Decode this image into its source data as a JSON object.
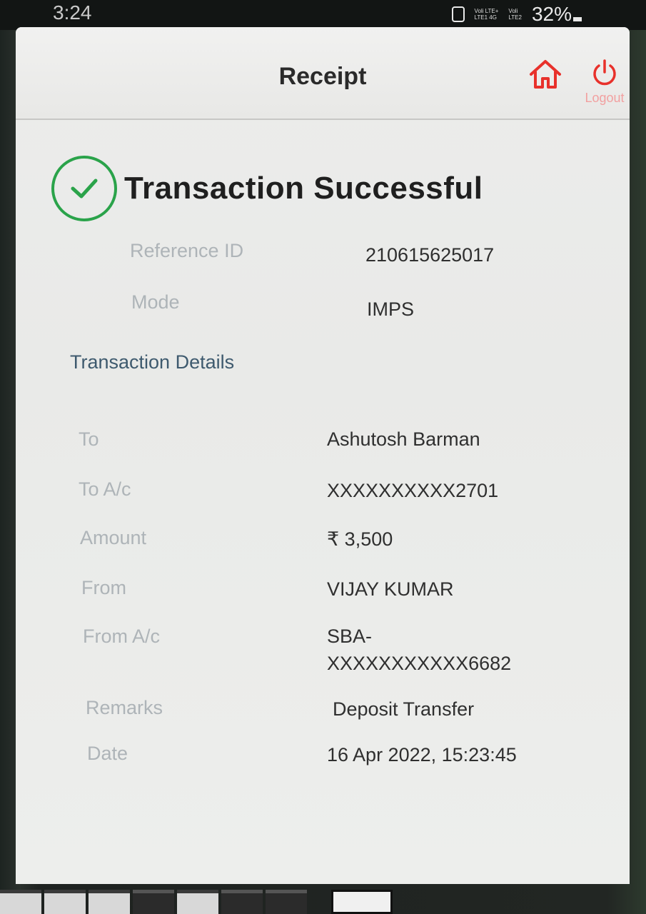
{
  "status_bar": {
    "time": "3:24",
    "network_1_top": "Voli LTE+",
    "network_1_bottom": "LTE1 4G",
    "network_2_top": "Voli",
    "network_2_bottom": "LTE2",
    "battery": "32%"
  },
  "header": {
    "title": "Receipt",
    "home_icon": "home-icon",
    "logout_icon": "power-icon",
    "logout_label": "Logout"
  },
  "status": {
    "icon": "check-circle-icon",
    "message": "Transaction Successful"
  },
  "summary": {
    "reference_label": "Reference ID",
    "reference_value": "210615625017",
    "mode_label": "Mode",
    "mode_value": "IMPS"
  },
  "details": {
    "section_title": "Transaction Details",
    "to_label": "To",
    "to_value": "Ashutosh Barman",
    "to_ac_label": "To A/c",
    "to_ac_value": "XXXXXXXXXX2701",
    "amount_label": "Amount",
    "amount_value": "₹ 3,500",
    "from_label": "From",
    "from_value": "VIJAY KUMAR",
    "from_ac_label": "From A/c",
    "from_ac_value_line1": "SBA-",
    "from_ac_value_line2": "XXXXXXXXXXX6682",
    "remarks_label": "Remarks",
    "remarks_value": "Deposit Transfer",
    "date_label": "Date",
    "date_value": "16 Apr 2022, 15:23:45"
  },
  "colors": {
    "accent_red": "#e8312b",
    "success_green": "#2aa34a",
    "section_title": "#3e5a6e"
  }
}
